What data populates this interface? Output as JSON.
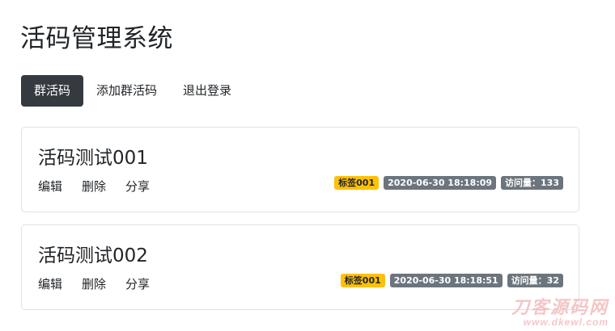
{
  "header": {
    "title": "活码管理系统"
  },
  "nav": {
    "items": [
      {
        "label": "群活码"
      },
      {
        "label": "添加群活码"
      },
      {
        "label": "退出登录"
      }
    ]
  },
  "cards": [
    {
      "title": "活码测试001",
      "actions": {
        "edit": "编辑",
        "delete": "删除",
        "share": "分享"
      },
      "tag": "标签001",
      "datetime": "2020-06-30 18:18:09",
      "views": "访问量：133"
    },
    {
      "title": "活码测试002",
      "actions": {
        "edit": "编辑",
        "delete": "删除",
        "share": "分享"
      },
      "tag": "标签001",
      "datetime": "2020-06-30 18:18:51",
      "views": "访问量：32"
    }
  ],
  "watermark": {
    "line1": "刀客源码网",
    "line2": "www.dkewl.com"
  },
  "colors": {
    "nav_active_bg": "#343a40",
    "badge_warning": "#ffc107",
    "badge_secondary": "#6c757d"
  }
}
